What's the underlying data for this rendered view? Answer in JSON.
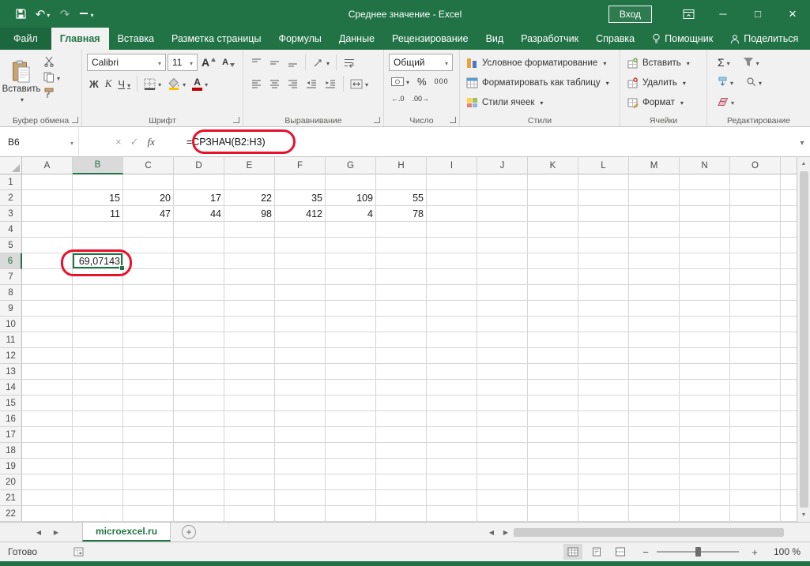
{
  "colors": {
    "excel_green": "#217346",
    "highlight_red": "#e8112d",
    "ribbon_bg": "#f1f1f1",
    "grid_line": "#d6d6d6",
    "header_bg": "#f4f4f4",
    "font_red": "#c00000",
    "fill_yellow": "#ffc000"
  },
  "title_bar": {
    "title": "Среднее значение  -  Excel",
    "sign_in_label": "Вход"
  },
  "ribbon": {
    "tabs": [
      {
        "label": "Файл"
      },
      {
        "label": "Главная"
      },
      {
        "label": "Вставка"
      },
      {
        "label": "Разметка страницы"
      },
      {
        "label": "Формулы"
      },
      {
        "label": "Данные"
      },
      {
        "label": "Рецензирование"
      },
      {
        "label": "Вид"
      },
      {
        "label": "Разработчик"
      },
      {
        "label": "Справка"
      },
      {
        "label": "Помощник"
      },
      {
        "label": "Поделиться"
      }
    ],
    "clipboard": {
      "label": "Буфер обмена",
      "paste": "Вставить"
    },
    "font": {
      "label": "Шрифт",
      "name": "Calibri",
      "size": "11",
      "bold": "Ж",
      "italic": "К",
      "underline": "Ч"
    },
    "alignment": {
      "label": "Выравнивание"
    },
    "number": {
      "label": "Число",
      "format": "Общий",
      "percent": "%",
      "thousands": "000"
    },
    "styles": {
      "label": "Стили",
      "conditional": "Условное форматирование",
      "format_table": "Форматировать как таблицу",
      "cell_styles": "Стили ячеек"
    },
    "cells": {
      "label": "Ячейки",
      "insert": "Вставить",
      "delete": "Удалить",
      "format": "Формат"
    },
    "editing": {
      "label": "Редактирование",
      "sum": "Σ"
    }
  },
  "formula_bar": {
    "name_box": "B6",
    "cancel": "×",
    "enter": "✓",
    "fx": "fx",
    "formula": "=СРЗНАЧ(B2:H3)"
  },
  "grid": {
    "columns": [
      "A",
      "B",
      "C",
      "D",
      "E",
      "F",
      "G",
      "H",
      "I",
      "J",
      "K",
      "L",
      "M",
      "N",
      "O"
    ],
    "row_count": 22,
    "selected_cell": "B6",
    "cells": {
      "B2": "15",
      "C2": "20",
      "D2": "17",
      "E2": "22",
      "F2": "35",
      "G2": "109",
      "H2": "55",
      "B3": "11",
      "C3": "47",
      "D3": "44",
      "E3": "98",
      "F3": "412",
      "G3": "4",
      "H3": "78",
      "B6": "69,07143"
    }
  },
  "sheet_bar": {
    "tabs": [
      {
        "label": "microexcel.ru",
        "active": true
      }
    ]
  },
  "status_bar": {
    "ready": "Готово",
    "zoom": "100 %"
  },
  "icons": {
    "letter_a": "А",
    "undo": "↶",
    "redo": "↷",
    "minimize": "─",
    "maximize": "□",
    "close": "×",
    "increase_decimal": "←.0",
    "decrease_decimal": ".00→",
    "zoom_out": "−",
    "zoom_in": "+",
    "prev": "◀",
    "next": "▶",
    "up": "▲",
    "down": "▼",
    "add_sheet": "+"
  }
}
